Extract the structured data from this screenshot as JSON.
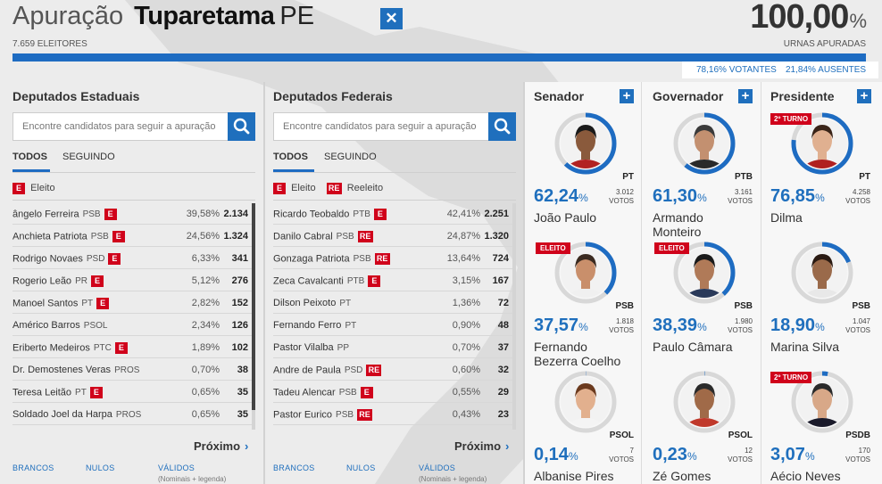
{
  "header": {
    "prefix": "Apuração",
    "city": "Tuparetama",
    "state": "PE",
    "close_symbol": "✕",
    "electors": "7.659 ELEITORES",
    "percent_value": "100,00",
    "percent_symbol": "%",
    "percent_label": "URNAS APURADAS",
    "progress": 1.0,
    "voters": "78,16% VOTANTES",
    "absent": "21,84% AUSENTES"
  },
  "estaduais": {
    "title": "Deputados Estaduais",
    "search_placeholder": "Encontre candidatos para seguir a apuração",
    "tab_all": "TODOS",
    "tab_following": "SEGUINDO",
    "legend_eleito": "Eleito",
    "badge_e": "E",
    "rows": [
      {
        "name": "ângelo Ferreira",
        "party": "PSB",
        "badge": "E",
        "pct": "39,58%",
        "votes": "2.134"
      },
      {
        "name": "Anchieta Patriota",
        "party": "PSB",
        "badge": "E",
        "pct": "24,56%",
        "votes": "1.324"
      },
      {
        "name": "Rodrigo Novaes",
        "party": "PSD",
        "badge": "E",
        "pct": "6,33%",
        "votes": "341"
      },
      {
        "name": "Rogerio Leão",
        "party": "PR",
        "badge": "E",
        "pct": "5,12%",
        "votes": "276"
      },
      {
        "name": "Manoel Santos",
        "party": "PT",
        "badge": "E",
        "pct": "2,82%",
        "votes": "152"
      },
      {
        "name": "Américo Barros",
        "party": "PSOL",
        "badge": "",
        "pct": "2,34%",
        "votes": "126"
      },
      {
        "name": "Eriberto Medeiros",
        "party": "PTC",
        "badge": "E",
        "pct": "1,89%",
        "votes": "102"
      },
      {
        "name": "Dr. Demostenes Veras",
        "party": "PROS",
        "badge": "",
        "pct": "0,70%",
        "votes": "38"
      },
      {
        "name": "Teresa Leitão",
        "party": "PT",
        "badge": "E",
        "pct": "0,65%",
        "votes": "35"
      },
      {
        "name": "Soldado Joel da Harpa",
        "party": "PROS",
        "badge": "",
        "pct": "0,65%",
        "votes": "35"
      }
    ],
    "next_label": "Próximo",
    "footer": {
      "brancos": "BRANCOS",
      "nulos": "NULOS",
      "validos": "VÁLIDOS",
      "validos_sub": "(Nominais + legenda)"
    }
  },
  "federais": {
    "title": "Deputados Federais",
    "search_placeholder": "Encontre candidatos para seguir a apuração",
    "tab_all": "TODOS",
    "tab_following": "SEGUINDO",
    "legend_eleito": "Eleito",
    "legend_reeleito": "Reeleito",
    "badge_e": "E",
    "badge_re": "RE",
    "rows": [
      {
        "name": "Ricardo Teobaldo",
        "party": "PTB",
        "badge": "E",
        "pct": "42,41%",
        "votes": "2.251"
      },
      {
        "name": "Danilo Cabral",
        "party": "PSB",
        "badge": "RE",
        "pct": "24,87%",
        "votes": "1.320"
      },
      {
        "name": "Gonzaga Patriota",
        "party": "PSB",
        "badge": "RE",
        "pct": "13,64%",
        "votes": "724"
      },
      {
        "name": "Zeca Cavalcanti",
        "party": "PTB",
        "badge": "E",
        "pct": "3,15%",
        "votes": "167"
      },
      {
        "name": "Dilson Peixoto",
        "party": "PT",
        "badge": "",
        "pct": "1,36%",
        "votes": "72"
      },
      {
        "name": "Fernando Ferro",
        "party": "PT",
        "badge": "",
        "pct": "0,90%",
        "votes": "48"
      },
      {
        "name": "Pastor Vilalba",
        "party": "PP",
        "badge": "",
        "pct": "0,70%",
        "votes": "37"
      },
      {
        "name": "Andre de Paula",
        "party": "PSD",
        "badge": "RE",
        "pct": "0,60%",
        "votes": "32"
      },
      {
        "name": "Tadeu Alencar",
        "party": "PSB",
        "badge": "E",
        "pct": "0,55%",
        "votes": "29"
      },
      {
        "name": "Pastor Eurico",
        "party": "PSB",
        "badge": "RE",
        "pct": "0,43%",
        "votes": "23"
      }
    ],
    "next_label": "Próximo",
    "footer": {
      "brancos": "BRANCOS",
      "nulos": "NULOS",
      "validos": "VÁLIDOS",
      "validos_sub": "(Nominais + legenda)"
    }
  },
  "senador": {
    "title": "Senador",
    "plus": "+",
    "candidates": [
      {
        "pct": "62,24",
        "party": "PT",
        "votes": "3.012",
        "votes_label": "VOTOS",
        "name1": "João Paulo",
        "name2": "",
        "flag": "",
        "share": 0.6224,
        "skin": "#8a5a3c",
        "hair": "#1a1a1a",
        "shirt": "#b22222"
      },
      {
        "pct": "37,57",
        "party": "PSB",
        "votes": "1.818",
        "votes_label": "VOTOS",
        "name1": "Fernando",
        "name2": "Bezerra Coelho",
        "flag": "ELEITO",
        "share": 0.3757,
        "skin": "#c98f6b",
        "hair": "#3a2a20",
        "shirt": "#f0f0f0"
      },
      {
        "pct": "0,14",
        "party": "PSOL",
        "votes": "7",
        "votes_label": "VOTOS",
        "name1": "Albanise Pires",
        "name2": "",
        "flag": "",
        "share": 0.0014,
        "skin": "#e2b08e",
        "hair": "#6b3a1e",
        "shirt": "#f4f4f4"
      }
    ]
  },
  "governador": {
    "title": "Governador",
    "plus": "+",
    "candidates": [
      {
        "pct": "61,30",
        "party": "PTB",
        "votes": "3.161",
        "votes_label": "VOTOS",
        "name1": "Armando",
        "name2": "Monteiro",
        "flag": "",
        "share": 0.613,
        "skin": "#c39070",
        "hair": "#3a3a3a",
        "shirt": "#2a2a2a"
      },
      {
        "pct": "38,39",
        "party": "PSB",
        "votes": "1.980",
        "votes_label": "VOTOS",
        "name1": "Paulo Câmara",
        "name2": "",
        "flag": "ELEITO",
        "share": 0.3839,
        "skin": "#b07a58",
        "hair": "#1a1a1a",
        "shirt": "#2a3a5a"
      },
      {
        "pct": "0,23",
        "party": "PSOL",
        "votes": "12",
        "votes_label": "VOTOS",
        "name1": "Zé Gomes",
        "name2": "",
        "flag": "",
        "share": 0.0023,
        "skin": "#a06a48",
        "hair": "#2a2a2a",
        "shirt": "#c0392b"
      }
    ]
  },
  "presidente": {
    "title": "Presidente",
    "plus": "+",
    "candidates": [
      {
        "pct": "76,85",
        "party": "PT",
        "votes": "4.258",
        "votes_label": "VOTOS",
        "name1": "Dilma",
        "name2": "",
        "flag": "2º TURNO",
        "share": 0.7685,
        "skin": "#e0b090",
        "hair": "#3a2418",
        "shirt": "#b02020"
      },
      {
        "pct": "18,90",
        "party": "PSB",
        "votes": "1.047",
        "votes_label": "VOTOS",
        "name1": "Marina Silva",
        "name2": "",
        "flag": "",
        "share": 0.189,
        "skin": "#9a6a4a",
        "hair": "#2a1a12",
        "shirt": "#e8e8e8"
      },
      {
        "pct": "3,07",
        "party": "PSDB",
        "votes": "170",
        "votes_label": "VOTOS",
        "name1": "Aécio Neves",
        "name2": "",
        "flag": "2º TURNO",
        "share": 0.0307,
        "skin": "#d8a888",
        "hair": "#2a2a2a",
        "shirt": "#1a1a2a"
      }
    ]
  }
}
